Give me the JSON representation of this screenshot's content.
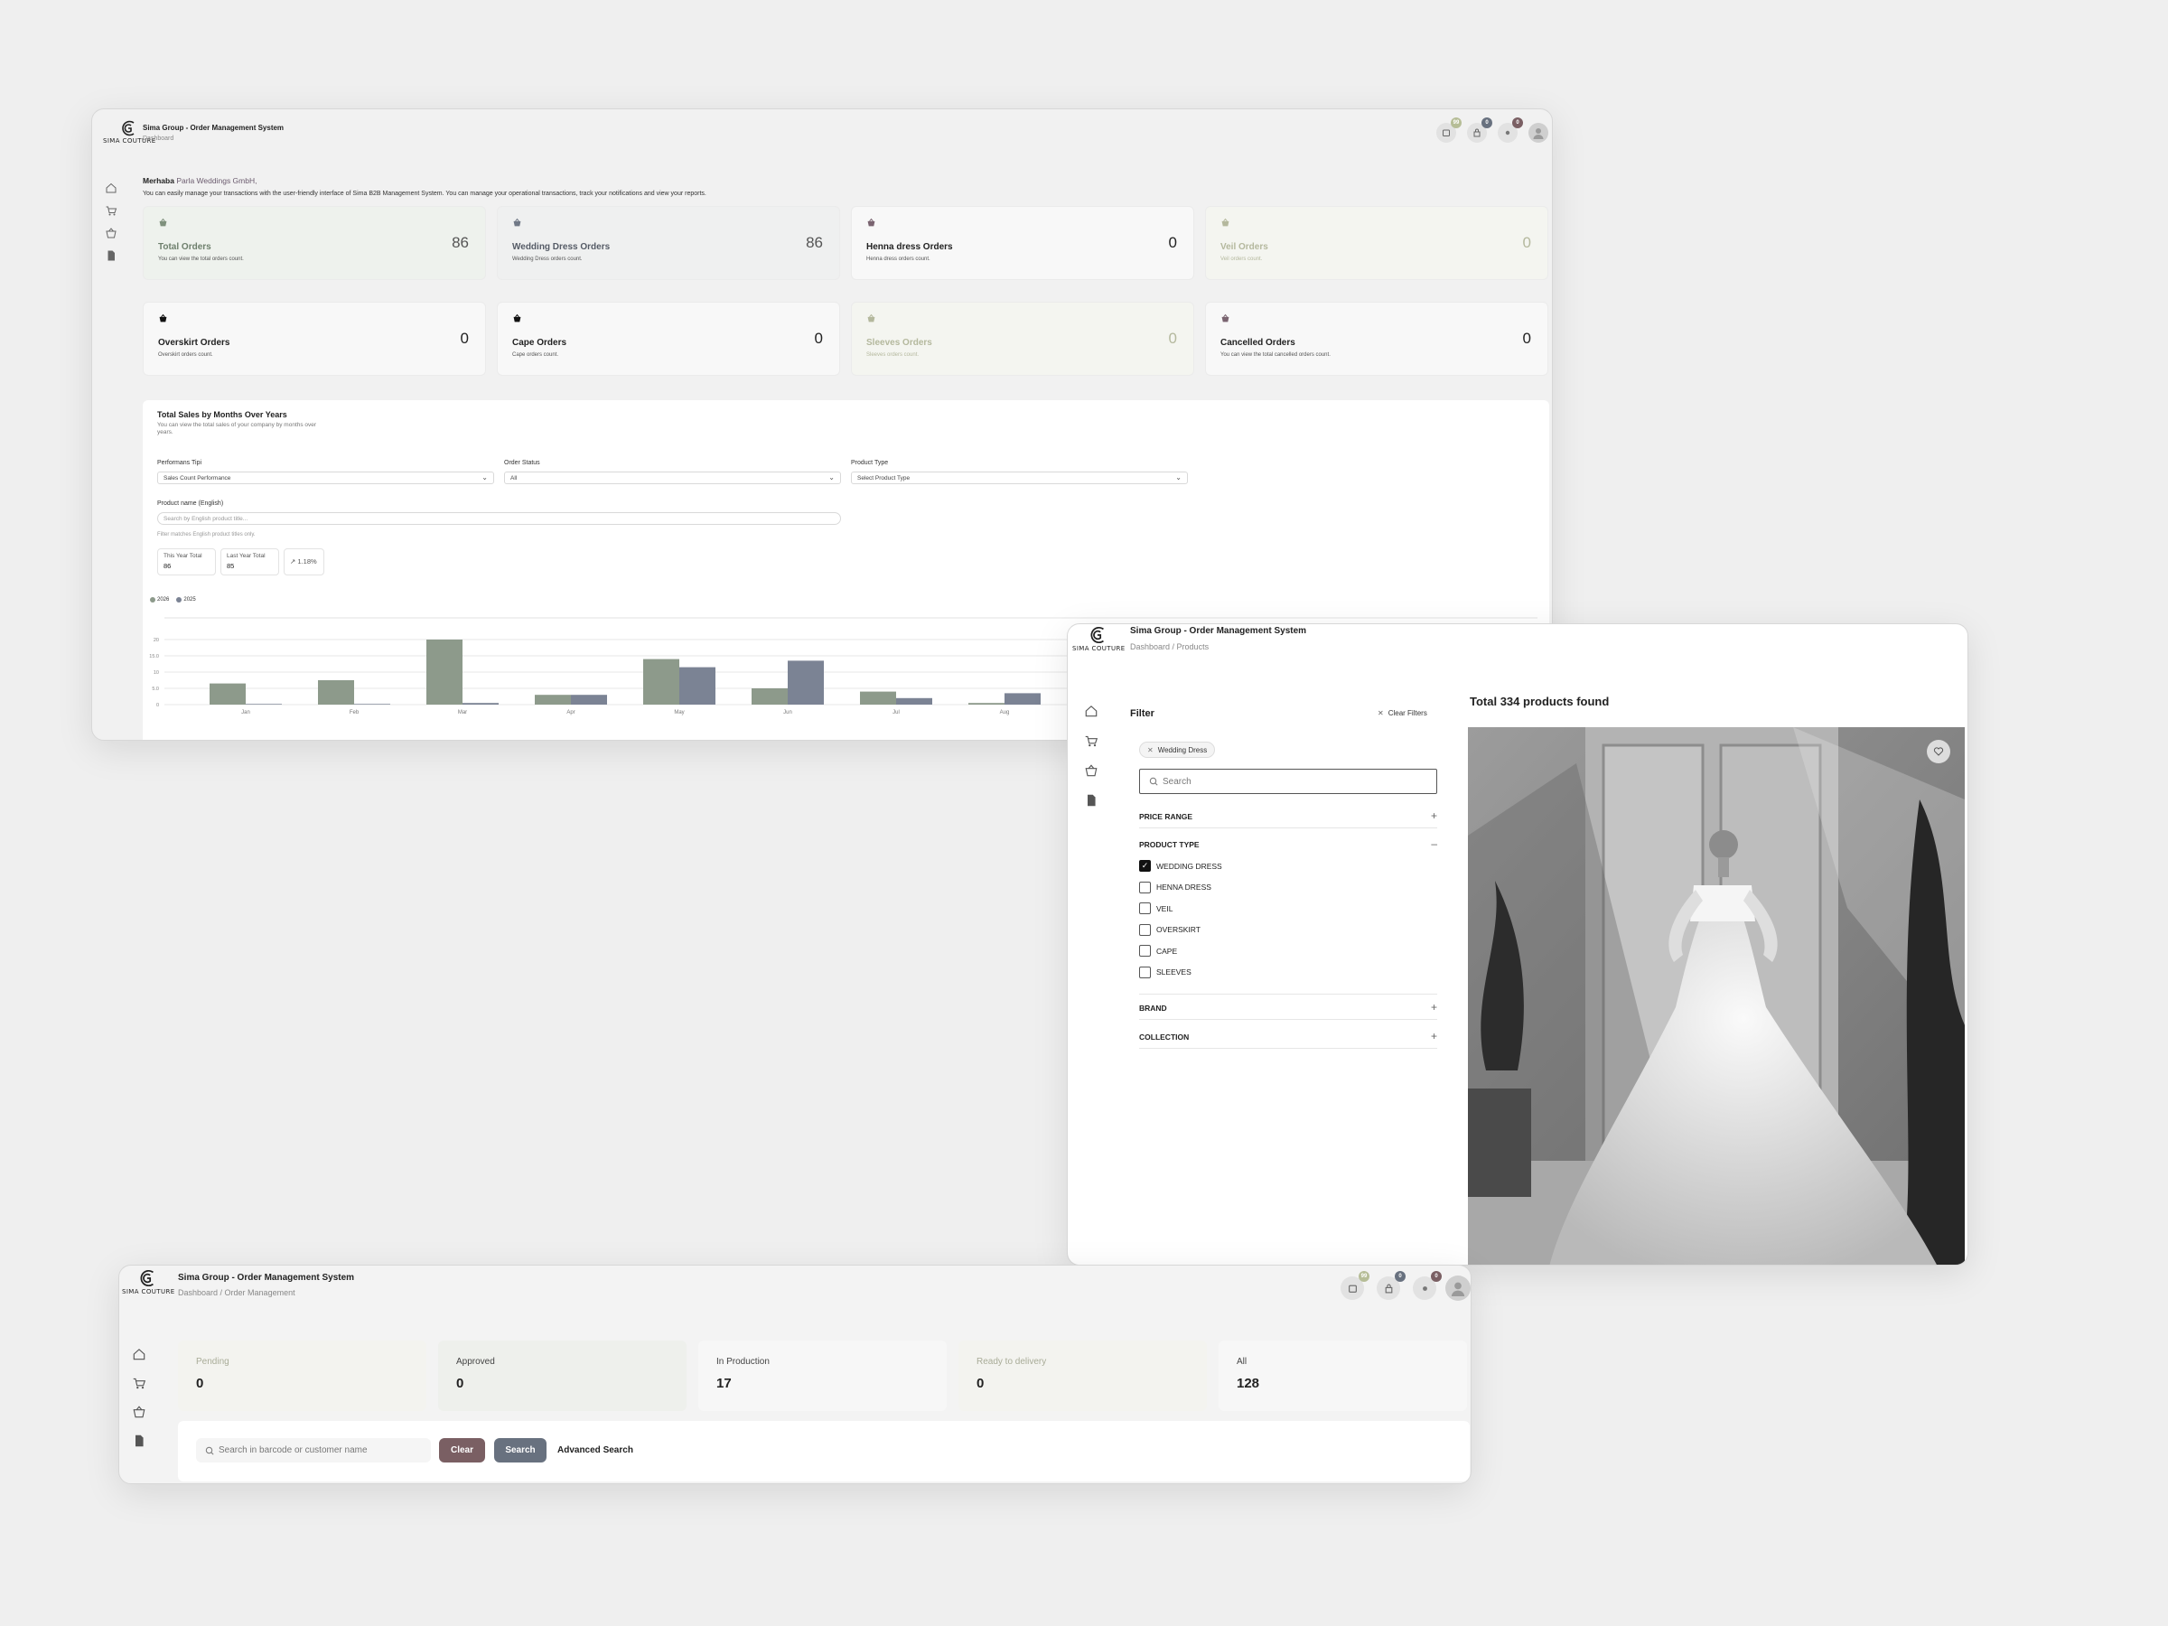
{
  "dashboard": {
    "logo_text": "SIMA COUTURE",
    "app_title": "Sima Group - Order Management System",
    "breadcrumb": "Dashboard",
    "badges": {
      "orders": "99",
      "cart": "0",
      "notifications": "0"
    },
    "welcome": {
      "greeting": "Merhaba",
      "org": "Parla Weddings GmbH,",
      "message": "You can easily manage your transactions with the user-friendly interface of Sima B2B Management System. You can manage your operational transactions, track your notifications and view your reports."
    },
    "cards": [
      {
        "title": "Total Orders",
        "desc": "You can view the total orders count.",
        "value": "86",
        "tone": "green",
        "icon_color": "#7f917d"
      },
      {
        "title": "Wedding Dress Orders",
        "desc": "Wedding Dress orders count.",
        "value": "86",
        "tone": "grey",
        "icon_color": "#707886"
      },
      {
        "title": "Henna dress Orders",
        "desc": "Henna dress orders count.",
        "value": "0",
        "tone": "plain",
        "icon_color": "#7a6470"
      },
      {
        "title": "Veil Orders",
        "desc": "Veil orders count.",
        "value": "0",
        "tone": "faint",
        "icon_color": "#b4b89d"
      },
      {
        "title": "Overskirt Orders",
        "desc": "Overskirt orders count.",
        "value": "0",
        "tone": "plain",
        "icon_color": "#111111"
      },
      {
        "title": "Cape Orders",
        "desc": "Cape orders count.",
        "value": "0",
        "tone": "plain",
        "icon_color": "#111111"
      },
      {
        "title": "Sleeves Orders",
        "desc": "Sleeves orders count.",
        "value": "0",
        "tone": "faint",
        "icon_color": "#b4b89d"
      },
      {
        "title": "Cancelled Orders",
        "desc": "You can view the total cancelled orders count.",
        "value": "0",
        "tone": "plain",
        "icon_color": "#7a6470"
      }
    ],
    "sales": {
      "title": "Total Sales by Months Over Years",
      "subtitle": "You can view the total sales of your company by months over years.",
      "filters": {
        "performance_label": "Performans Tipi",
        "performance_value": "Sales Count Performance",
        "status_label": "Order Status",
        "status_value": "All",
        "product_type_label": "Product Type",
        "product_type_value": "Select Product Type",
        "product_name_label": "Product name (English)",
        "product_name_placeholder": "Search by English product title...",
        "hint": "Filter matches English product titles only."
      },
      "totals": {
        "this_year_label": "This Year Total",
        "this_year_value": "86",
        "last_year_label": "Last Year Total",
        "last_year_value": "85",
        "change": "1.18%"
      }
    }
  },
  "chart_data": {
    "type": "bar",
    "categories": [
      "Jan",
      "Feb",
      "Mar",
      "Apr",
      "May",
      "Jun",
      "Jul",
      "Aug"
    ],
    "series": [
      {
        "name": "2026",
        "values": [
          6.5,
          7.5,
          20,
          3,
          14,
          5,
          4,
          0.5
        ],
        "color": "#8d9a8b"
      },
      {
        "name": "2025",
        "values": [
          0.2,
          0.2,
          0.5,
          3,
          11.5,
          13.5,
          2,
          3.5
        ],
        "color": "#7b8394"
      }
    ],
    "yticks": [
      "0",
      "5.0",
      "10",
      "15.0",
      "20"
    ],
    "ylim": [
      0,
      27
    ]
  },
  "products": {
    "logo_text": "SIMA COUTURE",
    "app_title": "Sima Group - Order Management System",
    "breadcrumb": [
      "Dashboard",
      "Products"
    ],
    "filter_title": "Filter",
    "clear_filters": "Clear Filters",
    "active_chip": "Wedding Dress",
    "search_placeholder": "Search",
    "sections": {
      "price": "PRICE RANGE",
      "product_type": "PRODUCT TYPE",
      "brand": "BRAND",
      "collection": "COLLECTION"
    },
    "types": [
      {
        "label": "WEDDING DRESS",
        "checked": true
      },
      {
        "label": "HENNA DRESS",
        "checked": false
      },
      {
        "label": "VEIL",
        "checked": false
      },
      {
        "label": "OVERSKIRT",
        "checked": false
      },
      {
        "label": "CAPE",
        "checked": false
      },
      {
        "label": "SLEEVES",
        "checked": false
      }
    ],
    "total_found": "Total 334 products found"
  },
  "orders": {
    "logo_text": "SIMA COUTURE",
    "app_title": "Sima Group - Order Management System",
    "breadcrumb": [
      "Dashboard",
      "Order Management"
    ],
    "badges": {
      "orders": "99",
      "cart": "0",
      "notifications": "0"
    },
    "stats": [
      {
        "label": "Pending",
        "value": "0",
        "tone": "faint",
        "bg": "#f3f3ef"
      },
      {
        "label": "Approved",
        "value": "0",
        "tone": "plain",
        "bg": "#eef0ec"
      },
      {
        "label": "In Production",
        "value": "17",
        "tone": "plain",
        "bg": "#f7f7f7"
      },
      {
        "label": "Ready to delivery",
        "value": "0",
        "tone": "faint",
        "bg": "#f3f3ef"
      },
      {
        "label": "All",
        "value": "128",
        "tone": "plain",
        "bg": "#f7f7f7"
      }
    ],
    "search_placeholder": "Search in barcode or customer name",
    "clear_label": "Clear",
    "search_label": "Search",
    "advanced_label": "Advanced Search"
  },
  "colors": {
    "clear_button": "#7a5f63",
    "search_button": "#68717f",
    "badge_green": "#b6bd97",
    "badge_blue": "#68717f",
    "badge_mauve": "#7a5f63"
  }
}
